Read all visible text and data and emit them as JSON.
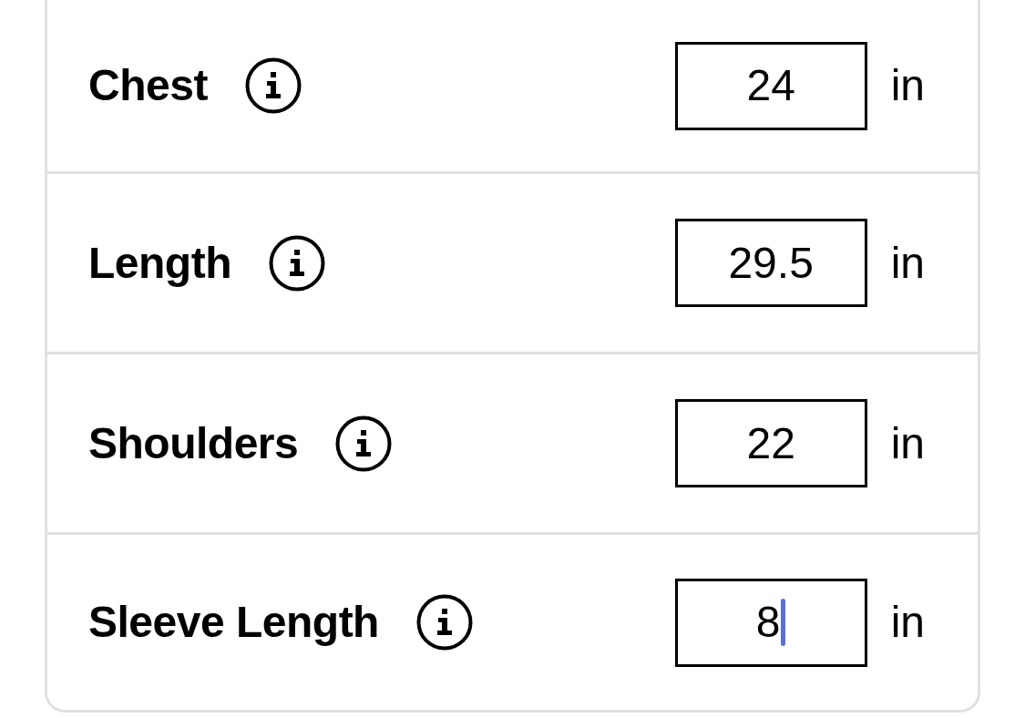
{
  "measurements": [
    {
      "label": "Chest",
      "value": "24",
      "unit": "in",
      "focused": false
    },
    {
      "label": "Length",
      "value": "29.5",
      "unit": "in",
      "focused": false
    },
    {
      "label": "Shoulders",
      "value": "22",
      "unit": "in",
      "focused": false
    },
    {
      "label": "Sleeve Length",
      "value": "8",
      "unit": "in",
      "focused": true
    }
  ]
}
